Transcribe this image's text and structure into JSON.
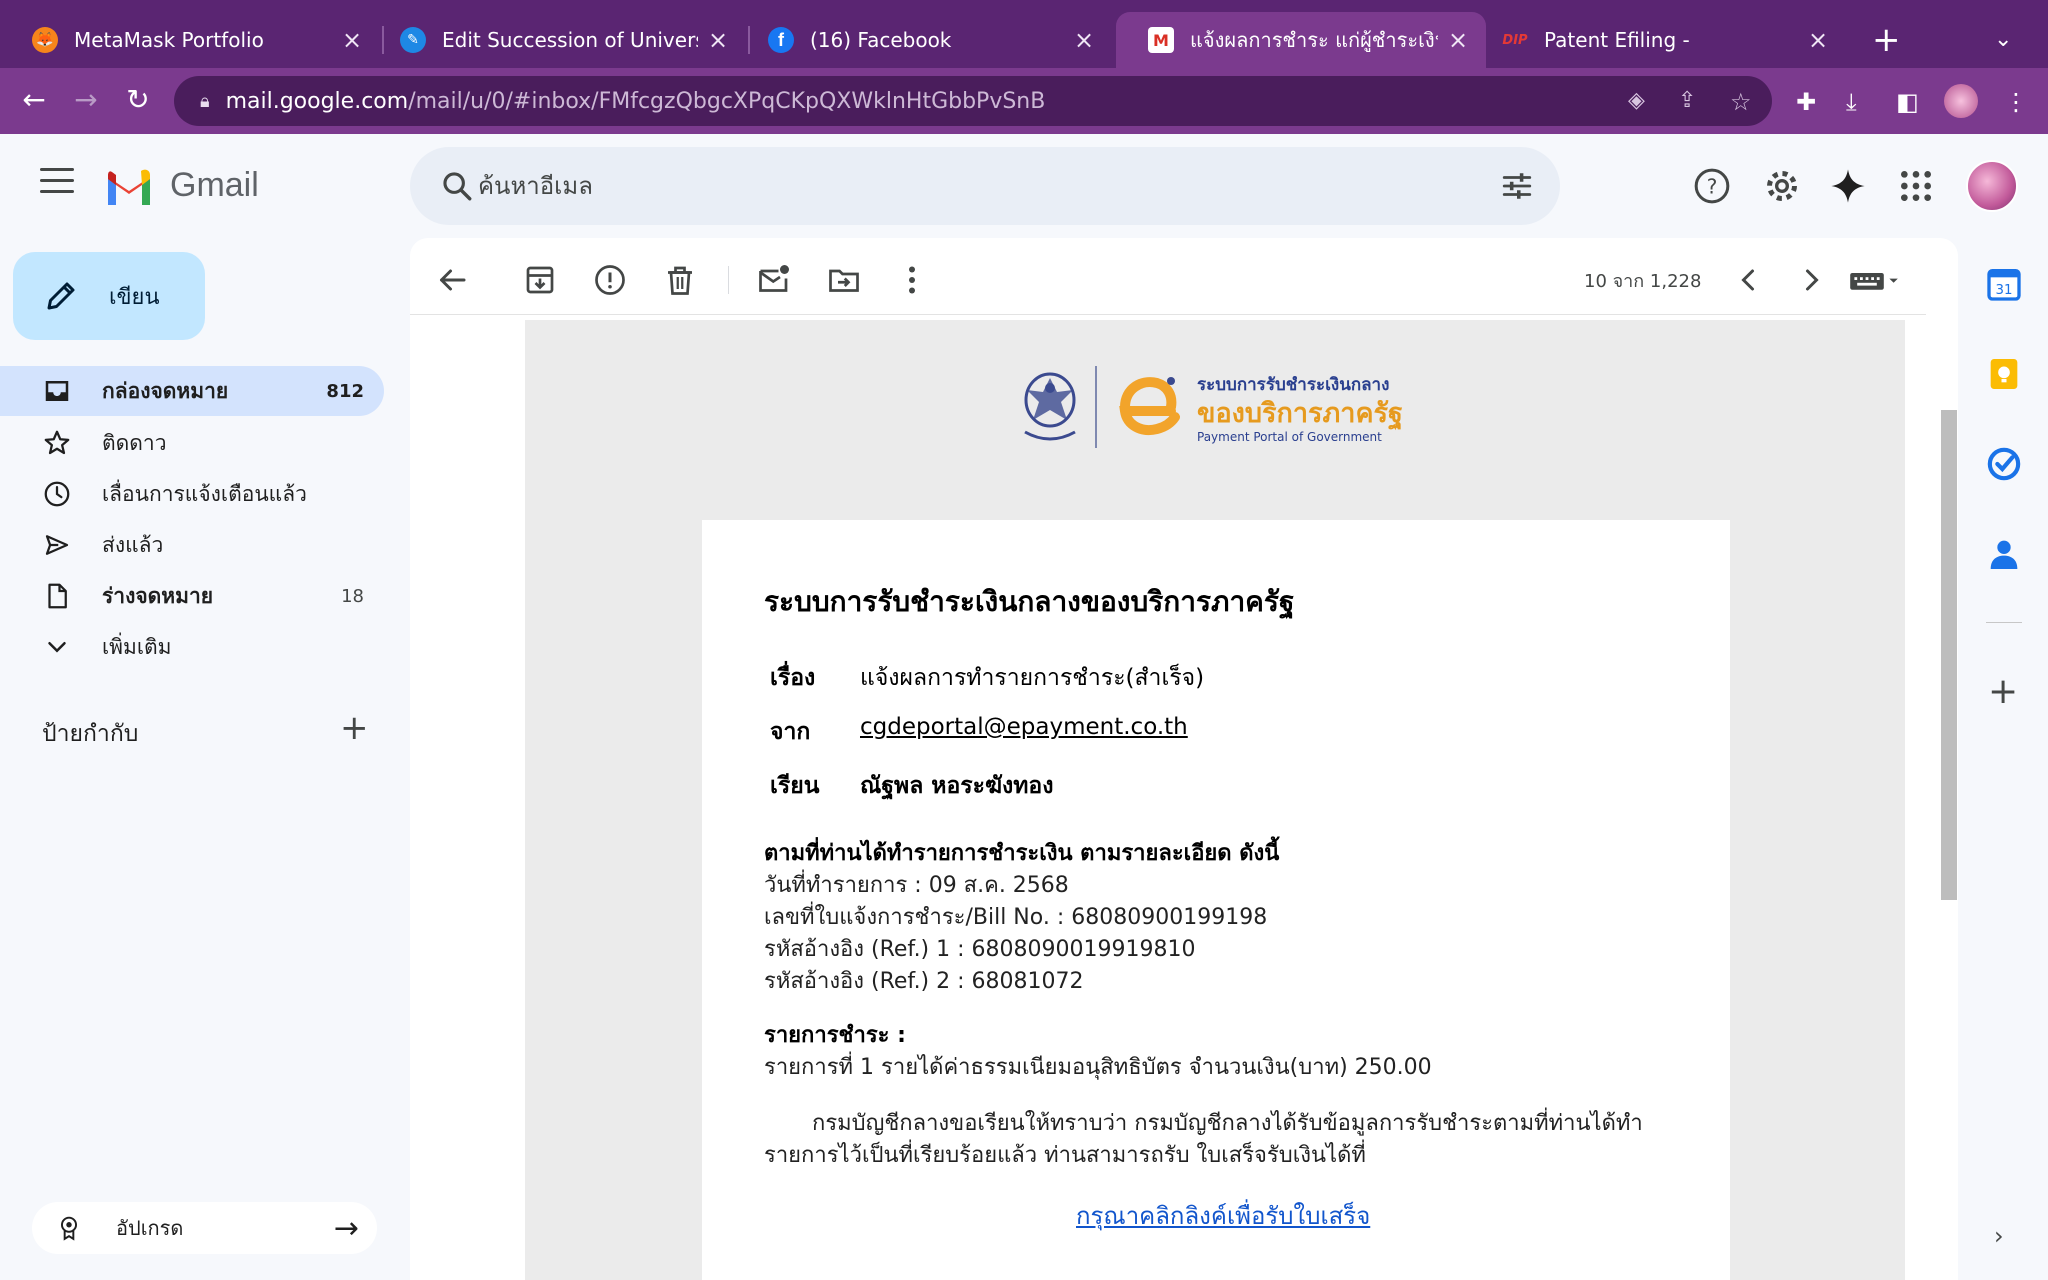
{
  "browser": {
    "tabs": [
      {
        "title": "MetaMask Portfolio",
        "icon": "metamask-icon",
        "active": false
      },
      {
        "title": "Edit Succession of Universe-I",
        "icon": "edit-site-icon",
        "active": false
      },
      {
        "title": "(16) Facebook",
        "icon": "facebook-icon",
        "active": false
      },
      {
        "title": "แจ้งผลการชำระ แก่ผู้ชำระเงิน - n",
        "icon": "gmail-icon",
        "active": true
      },
      {
        "title": "Patent Efiling -",
        "icon": "dip-icon",
        "active": false
      }
    ],
    "close_glyph": "×",
    "new_tab_glyph": "+",
    "url_domain": "mail.google.com",
    "url_path": "/mail/u/0/#inbox/FMfcgzQbgcXPqCKpQXWklnHtGbbPvSnB"
  },
  "gmail": {
    "logo_text": "Gmail",
    "search_placeholder": "ค้นหาอีเมล",
    "compose_label": "เขียน",
    "nav": [
      {
        "label": "กล่องจดหมาย",
        "count": "812",
        "icon": "inbox-icon",
        "active": true,
        "bold": true
      },
      {
        "label": "ติดดาว",
        "count": "",
        "icon": "star-icon",
        "active": false,
        "bold": false
      },
      {
        "label": "เลื่อนการแจ้งเตือนแล้ว",
        "count": "",
        "icon": "clock-icon",
        "active": false,
        "bold": false
      },
      {
        "label": "ส่งแล้ว",
        "count": "",
        "icon": "send-icon",
        "active": false,
        "bold": false
      },
      {
        "label": "ร่างจดหมาย",
        "count": "18",
        "icon": "draft-icon",
        "active": false,
        "bold": true
      },
      {
        "label": "เพิ่มเติม",
        "count": "",
        "icon": "chevron-down-icon",
        "active": false,
        "bold": false
      }
    ],
    "labels_heading": "ป้ายกำกับ",
    "upgrade_label": "อัปเกรด",
    "page_info": "10 จาก 1,228"
  },
  "email": {
    "portal_logo": {
      "line1": "ระบบการรับชำระเงินกลาง",
      "line2": "ของบริการภาครัฐ",
      "line3": "Payment Portal of Government"
    },
    "title": "ระบบการรับชำระเงินกลางของบริการภาครัฐ",
    "subject_label": "เรื่อง",
    "subject": "แจ้งผลการทำรายการชำระ(สำเร็จ)",
    "from_label": "จาก",
    "from": "cgdeportal@epayment.co.th",
    "to_label": "เรียน",
    "to": "ณัฐพล หอระฆังทอง",
    "details_heading": "ตามที่ท่านได้ทำรายการชำระเงิน ตามรายละเอียด ดังนี้",
    "details": [
      "วันที่ทำรายการ : 09 ส.ค. 2568",
      "เลขที่ใบแจ้งการชำระ/Bill No. : 68080900199198",
      "รหัสอ้างอิง (Ref.) 1 : 6808090019919810",
      "รหัสอ้างอิง (Ref.) 2 : 68081072"
    ],
    "items_heading": "รายการชำระ :",
    "items": [
      "รายการที่ 1 รายได้ค่าธรรมเนียมอนุสิทธิบัตร จำนวนเงิน(บาท) 250.00"
    ],
    "notice_line1": "กรมบัญชีกลางขอเรียนให้ทราบว่า กรมบัญชีกลางได้รับข้อมูลการรับชำระตามที่ท่านได้ทำ",
    "notice_line2": "รายการไว้เป็นที่เรียบร้อยแล้ว ท่านสามารถรับ ใบเสร็จรับเงินได้ที่",
    "receipt_link": "กรุณาคลิกลิงค์เพื่อรับใบเสร็จ"
  },
  "colors": {
    "chrome_tabbar": "#5a2572",
    "chrome_toolbar": "#7b3a8e",
    "compose_bg": "#c2e7ff",
    "active_nav": "#d3e3fd",
    "link": "#1155cc",
    "portal_orange": "#e69a1e",
    "portal_navy": "#2a3f8f"
  }
}
